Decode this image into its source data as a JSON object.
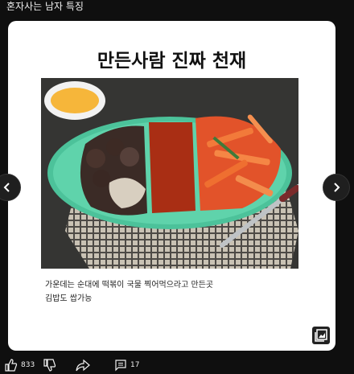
{
  "post": {
    "title": "혼자사는 남자 특징"
  },
  "card": {
    "headline": "만든사람 진짜 천재",
    "caption_lines": [
      "가운데는 순대에 떡볶이 국물 찍어먹으라고 만든곳",
      "김밥도 쌉가능"
    ]
  },
  "actions": {
    "like_count": "833",
    "comment_count": "17"
  },
  "icons": {
    "like": "thumbs-up-icon",
    "dislike": "thumbs-down-icon",
    "share": "share-icon",
    "comment": "comment-icon",
    "gallery": "image-gallery-icon",
    "prev": "chevron-left-icon",
    "next": "chevron-right-icon"
  }
}
